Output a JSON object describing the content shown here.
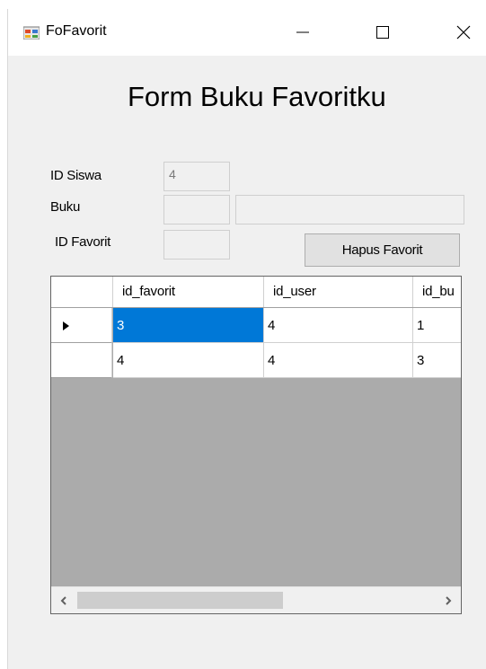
{
  "window": {
    "title": "FoFavorit",
    "icon": "winforms-app-icon"
  },
  "form": {
    "heading": "Form Buku Favoritku",
    "labels": {
      "id_siswa": "ID Siswa",
      "buku": "Buku",
      "id_favorit": "ID Favorit"
    },
    "inputs": {
      "id_siswa_value": "4",
      "buku_id_value": "",
      "buku_title_value": "",
      "id_favorit_value": ""
    },
    "hapus_button_label": "Hapus Favorit"
  },
  "grid": {
    "columns": [
      "id_favorit",
      "id_user",
      "id_bu"
    ],
    "rows": [
      {
        "cells": [
          "3",
          "4",
          "1"
        ],
        "current": true
      },
      {
        "cells": [
          "4",
          "4",
          "3"
        ],
        "current": false
      }
    ],
    "selected_cell_color": "#0078d7"
  },
  "icons": {
    "minimize": "minimize-icon",
    "maximize": "maximize-icon",
    "close": "close-icon",
    "row_pointer": "row-pointer-icon",
    "scroll_left": "scroll-left-arrow-icon",
    "scroll_right": "scroll-right-arrow-icon"
  }
}
